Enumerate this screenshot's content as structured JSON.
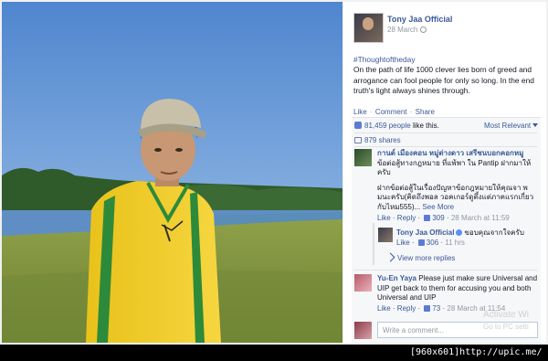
{
  "post": {
    "page_name": "Tony Jaa Official",
    "date": "28 March",
    "hashtag": "#Thoughtoftheday",
    "body": "On the path of life 1000 clever lies born of greed and arrogance can fool people for only so long. In the end truth's light always shines through.",
    "actions": {
      "like": "Like",
      "comment": "Comment",
      "share": "Share",
      "separator": "·"
    }
  },
  "stats": {
    "likes_count": "81,459 people",
    "likes_suffix": " like this.",
    "sort": "Most Relevant",
    "shares": "879 shares"
  },
  "comments": [
    {
      "author": "กานต์ เมืองคอน หมู่ต่างดาว เสรีชนบอกคอกหมู",
      "text1": "ข้อต่อสู้ทางกฎหมาย ที่แพ้พา ใน Pantip ฝากมาให้ ครับ",
      "text2": "ฝากข้อต่อสู้ในเรื่องปัญหาข้อกฎหมายให้คุณจา พมนะครับ(คิดถึงพอล วอคเกอร์ดูตึ้งแต่ภาคแรกเกี่ยวกับไหม555)...",
      "see_more": "See More",
      "like": "Like",
      "reply": "Reply",
      "likes": "309",
      "time": "28 March at 11:59"
    },
    {
      "author": "Tony Jaa Official",
      "text": "ขอบคุณจากใจครับ",
      "like": "Like",
      "likes": "306",
      "time": "11 hrs"
    },
    {
      "author": "Yu-En Yaya",
      "text": "Please just make sure Universal and UIP get back to them for accusing you and both Universal and UIP",
      "like": "Like",
      "reply": "Reply",
      "likes": "73",
      "time": "28 March at 11:54"
    }
  ],
  "view_more_replies": "View more replies",
  "write_placeholder": "Write a comment...",
  "watermark": {
    "line1": "Activate Wi",
    "line2": "Go to PC setti"
  },
  "footer": "[960x601]http://upic.me/",
  "colors": {
    "fb_blue": "#3b5998",
    "jersey_yellow": "#f2cc1f",
    "jersey_green": "#2d8a3a",
    "sky": "#6b9fd8"
  }
}
